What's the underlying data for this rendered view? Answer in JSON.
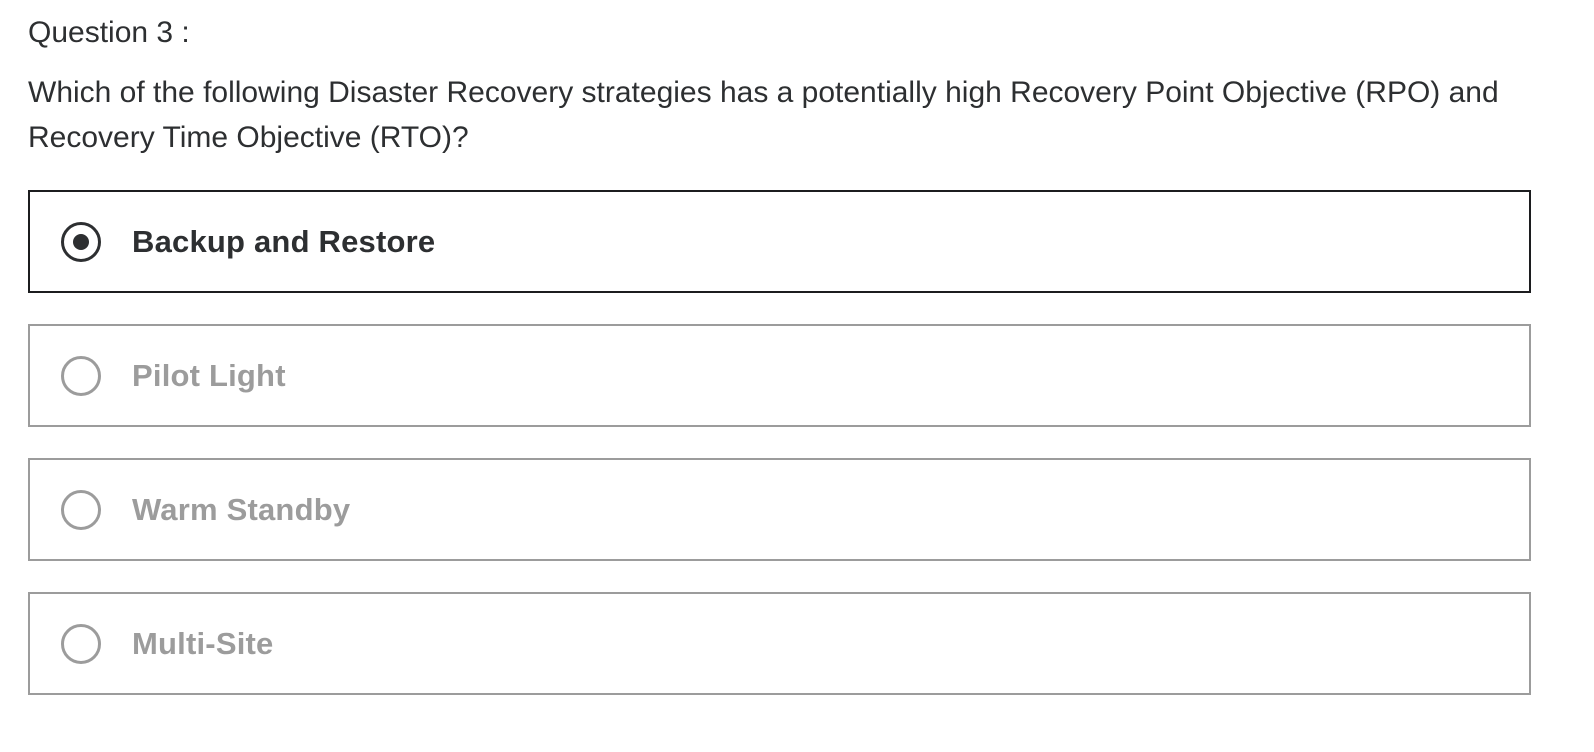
{
  "question": {
    "number_label": "Question 3 :",
    "text": "Which of the following Disaster Recovery strategies has a potentially high Recovery Point Objective (RPO) and Recovery Time Objective (RTO)?"
  },
  "options": [
    {
      "label": "Backup and Restore",
      "selected": true
    },
    {
      "label": "Pilot Light",
      "selected": false
    },
    {
      "label": "Warm Standby",
      "selected": false
    },
    {
      "label": "Multi-Site",
      "selected": false
    }
  ],
  "colors": {
    "text": "#2d2f31",
    "selected_border": "#1c1d1f",
    "unselected": "#9c9c9c",
    "background": "#ffffff"
  }
}
